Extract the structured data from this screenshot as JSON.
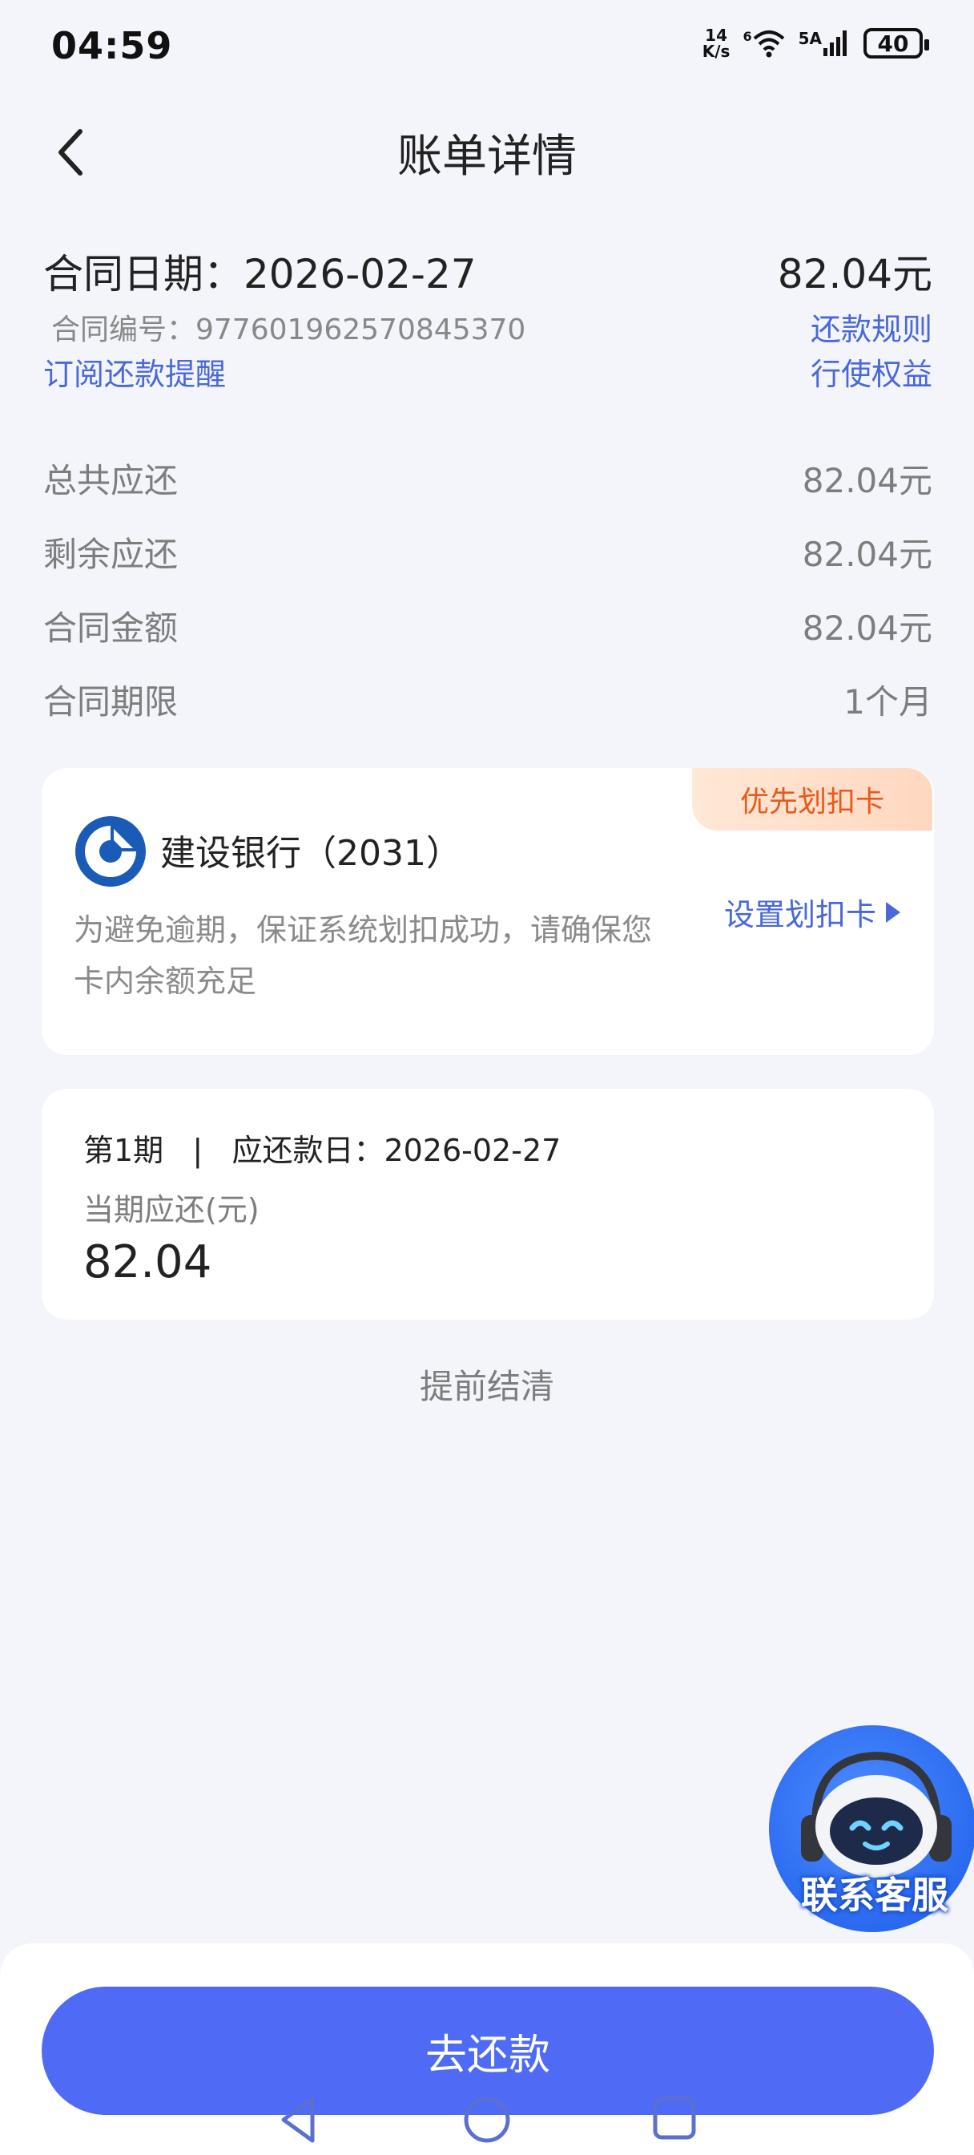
{
  "status_bar": {
    "time": "04:59",
    "net_speed_value": "14",
    "net_speed_unit": "K/s",
    "wifi_badge": "6",
    "signal_label": "5A",
    "battery": "40"
  },
  "header": {
    "title": "账单详情"
  },
  "contract": {
    "date_text": "合同日期：2026-02-27",
    "amount": "82.04元",
    "number_text": "合同编号：977601962570845370",
    "subscribe_link": "订阅还款提醒",
    "rules_link": "还款规则",
    "exercise_link": "行使权益"
  },
  "info_rows": [
    {
      "label": "总共应还",
      "value": "82.04元"
    },
    {
      "label": "剩余应还",
      "value": "82.04元"
    },
    {
      "label": "合同金额",
      "value": "82.04元"
    },
    {
      "label": "合同期限",
      "value": "1个月"
    }
  ],
  "bank_card": {
    "badge": "优先划扣卡",
    "name": "建设银行（2031）",
    "note": "为避免逾期，保证系统划扣成功，请确保您卡内余额充足",
    "set_link": "设置划扣卡"
  },
  "period": {
    "line": "第1期   |   应还款日：2026-02-27",
    "subtitle": "当期应还(元)",
    "amount": "82.04"
  },
  "early_settle": "提前结清",
  "customer_service": {
    "label": "联系客服"
  },
  "pay_button": "去还款",
  "colors": {
    "accent": "#4f6bf5",
    "link": "#4a68d8",
    "badge_text": "#e8591b",
    "background": "#f3f5fb"
  },
  "icons": [
    "back-arrow-icon",
    "wifi-icon",
    "signal-icon",
    "battery-icon",
    "ccb-bank-logo-icon",
    "triangle-right-icon",
    "robot-support-icon",
    "nav-back-icon",
    "nav-home-icon",
    "nav-recents-icon"
  ]
}
